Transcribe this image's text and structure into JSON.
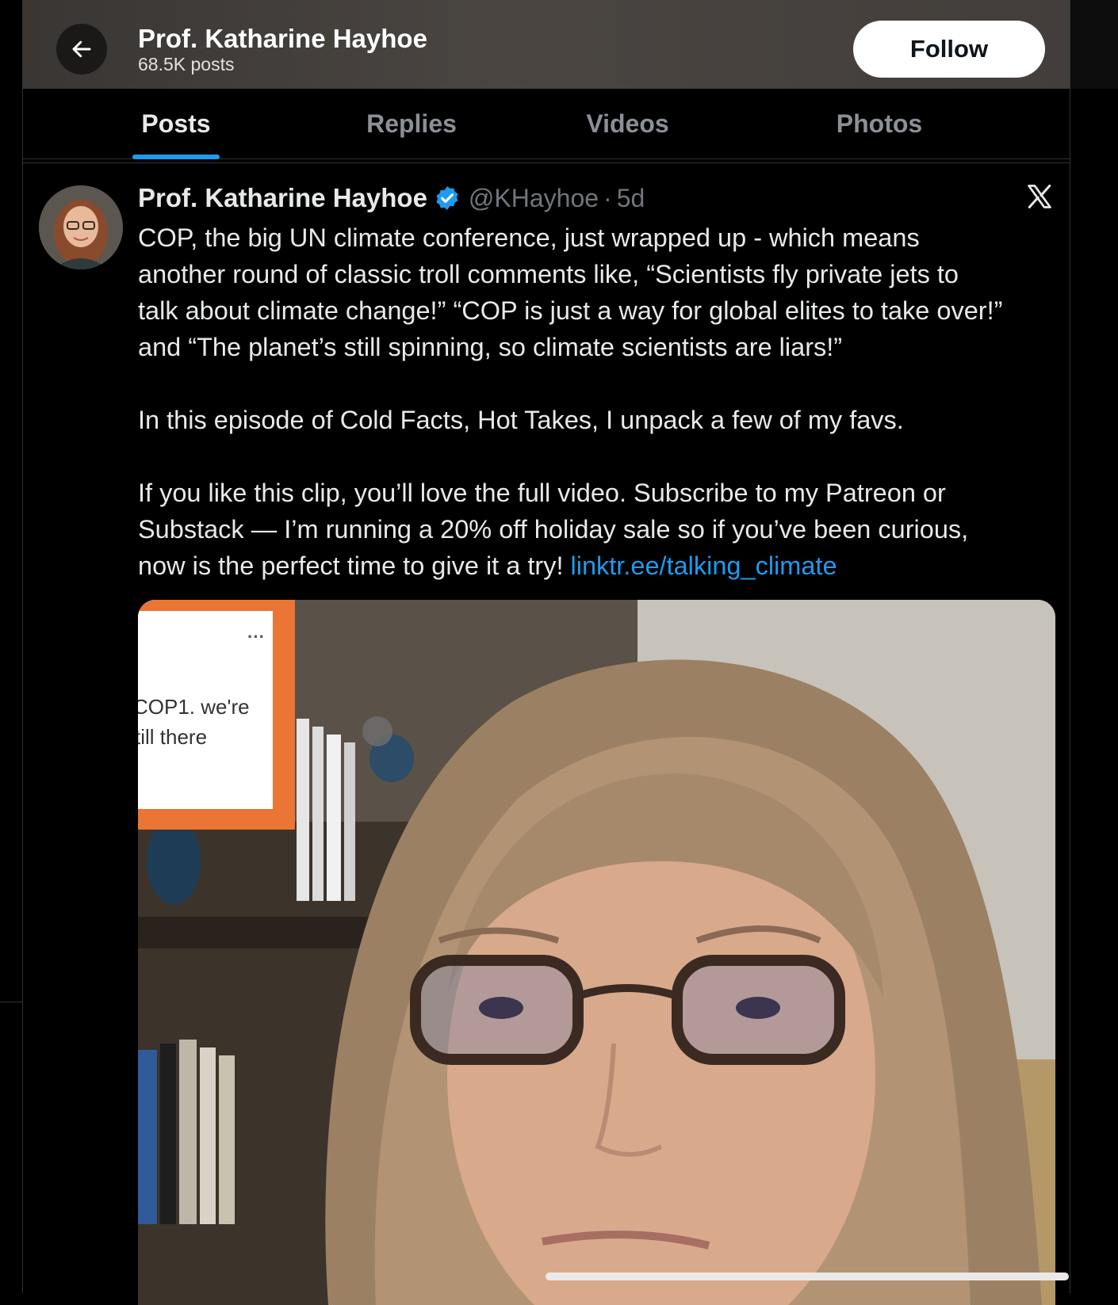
{
  "header": {
    "name": "Prof. Katharine Hayhoe",
    "posts_count": "68.5K posts",
    "follow_label": "Follow"
  },
  "tabs": [
    {
      "label": "Posts",
      "active": true
    },
    {
      "label": "Replies",
      "active": false
    },
    {
      "label": "Videos",
      "active": false
    },
    {
      "label": "Photos",
      "active": false
    }
  ],
  "post": {
    "author": "Prof. Katharine Hayhoe",
    "handle": "@KHayhoe",
    "separator": "·",
    "time": "5d",
    "paragraph1": [
      "COP, the big UN climate conference, just wrapped up - which means",
      "another round of classic troll comments like, “Scientists fly private jets to",
      "talk about climate change!” “COP is just a way for global elites to take over!”",
      "and “The planet’s still spinning, so climate scientists are liars!”"
    ],
    "paragraph2": "In this episode of Cold Facts, Hot Takes, I unpack a few of my favs.",
    "paragraph3": [
      "If you like this clip, you’ll love the full video. Subscribe to my Patreon or",
      "Substack — I’m running a 20% off holiday sale so if you’ve been curious,",
      "now is the perfect time to give it a try! "
    ],
    "link": "linktr.ee/talking_climate",
    "media": {
      "overlay_dots": "···",
      "overlay_line1": "COP1. we're",
      "overlay_line2": "till there"
    }
  },
  "colors": {
    "accent": "#1d9bf0",
    "background": "#000000",
    "text": "#e7e9ea",
    "muted": "#71767b",
    "overlay_frame": "#ea7534"
  },
  "icons": [
    "back-arrow-icon",
    "verified-badge-icon",
    "x-logo-icon",
    "more-dots-icon"
  ]
}
